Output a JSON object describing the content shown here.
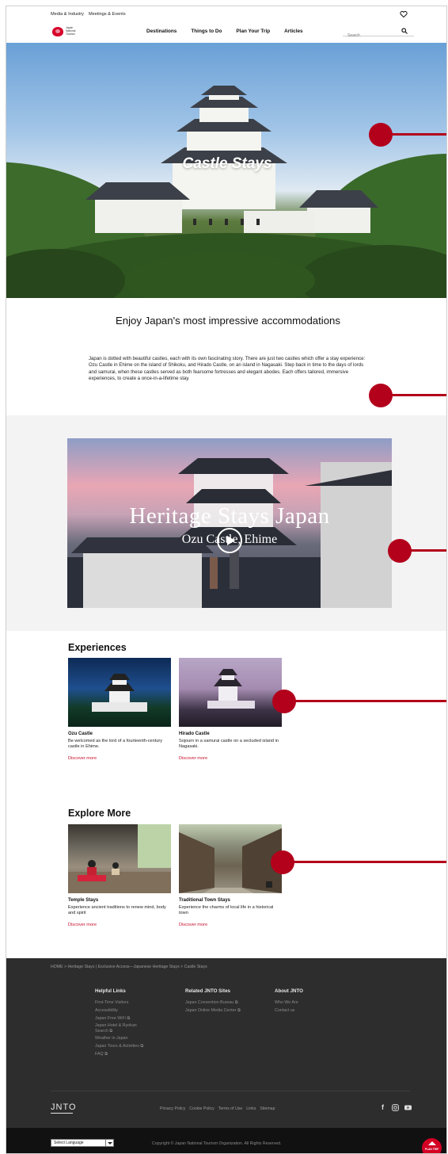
{
  "utility": {
    "links": [
      "Media & Industry",
      "Meetings & Events"
    ]
  },
  "logo": {
    "lines": [
      "Japan",
      "National",
      "Tourism"
    ]
  },
  "nav": {
    "items": [
      "Destinations",
      "Things to Do",
      "Plan Your Trip",
      "Articles"
    ],
    "search_placeholder": "Search"
  },
  "hero": {
    "title": "Castle Stays"
  },
  "intro": {
    "heading": "Enjoy Japan's most impressive accommodations",
    "body": "Japan is dotted with beautiful castles, each with its own fascinating story. There are just two castles which offer a stay experience: Ozu Castle in Ehime on the island of Shikoku, and Hirado Castle, on an island in Nagasaki. Step back in time to the days of lords and samurai, when these castles served as both fearsome fortresses and elegant abodes. Each offers tailored, immersive experiences, to create a once-in-a-lifetime stay."
  },
  "video": {
    "title": "Heritage Stays Japan",
    "subtitle": "Ozu Castle, Ehime"
  },
  "experiences": {
    "heading": "Experiences",
    "cards": [
      {
        "title": "Ozu Castle",
        "desc": "Be welcomed as the lord of a fourteenth-century castle in Ehime.",
        "link": "Discover more"
      },
      {
        "title": "Hirado Castle",
        "desc": "Sojourn in a samurai castle on a secluded island in Nagasaki.",
        "link": "Discover more"
      }
    ]
  },
  "explore": {
    "heading": "Explore More",
    "cards": [
      {
        "title": "Temple Stays",
        "desc": "Experience ancient traditions to renew mind, body and spirit",
        "link": "Discover more"
      },
      {
        "title": "Traditional Town Stays",
        "desc": "Experience the charms of local life in a historical town",
        "link": "Discover more"
      }
    ]
  },
  "footer": {
    "breadcrumb": "HOME > Heritage Stays | Exclusive Access—Japanese Heritage Stays > Castle Stays",
    "helpful": {
      "heading": "Helpful Links",
      "items": [
        "First-Time Visitors",
        "Accessibility",
        "Japan Free WiFi",
        "Japan Hotel & Ryokan Search",
        "Weather in Japan",
        "Japan Tours & Activities",
        "FAQ"
      ]
    },
    "related": {
      "heading": "Related JNTO Sites",
      "items": [
        "Japan Convention Bureau",
        "Japan Online Media Center"
      ]
    },
    "about": {
      "heading": "About JNTO",
      "items": [
        "Who We Are",
        "Contact us"
      ]
    },
    "brand": "JNTO",
    "links": [
      "Privacy Policy",
      "Cookie Policy",
      "Terms of Use",
      "Links",
      "Sitemap"
    ],
    "language": "Select Language",
    "copyright": "Copyright © Japan National Tourism Organization. All Rights Reserved.",
    "plan_button": "PLAN TRIP"
  },
  "colors": {
    "accent": "#c8102e",
    "callout": "#b3001b",
    "footer_bg": "#2d2d2d"
  }
}
